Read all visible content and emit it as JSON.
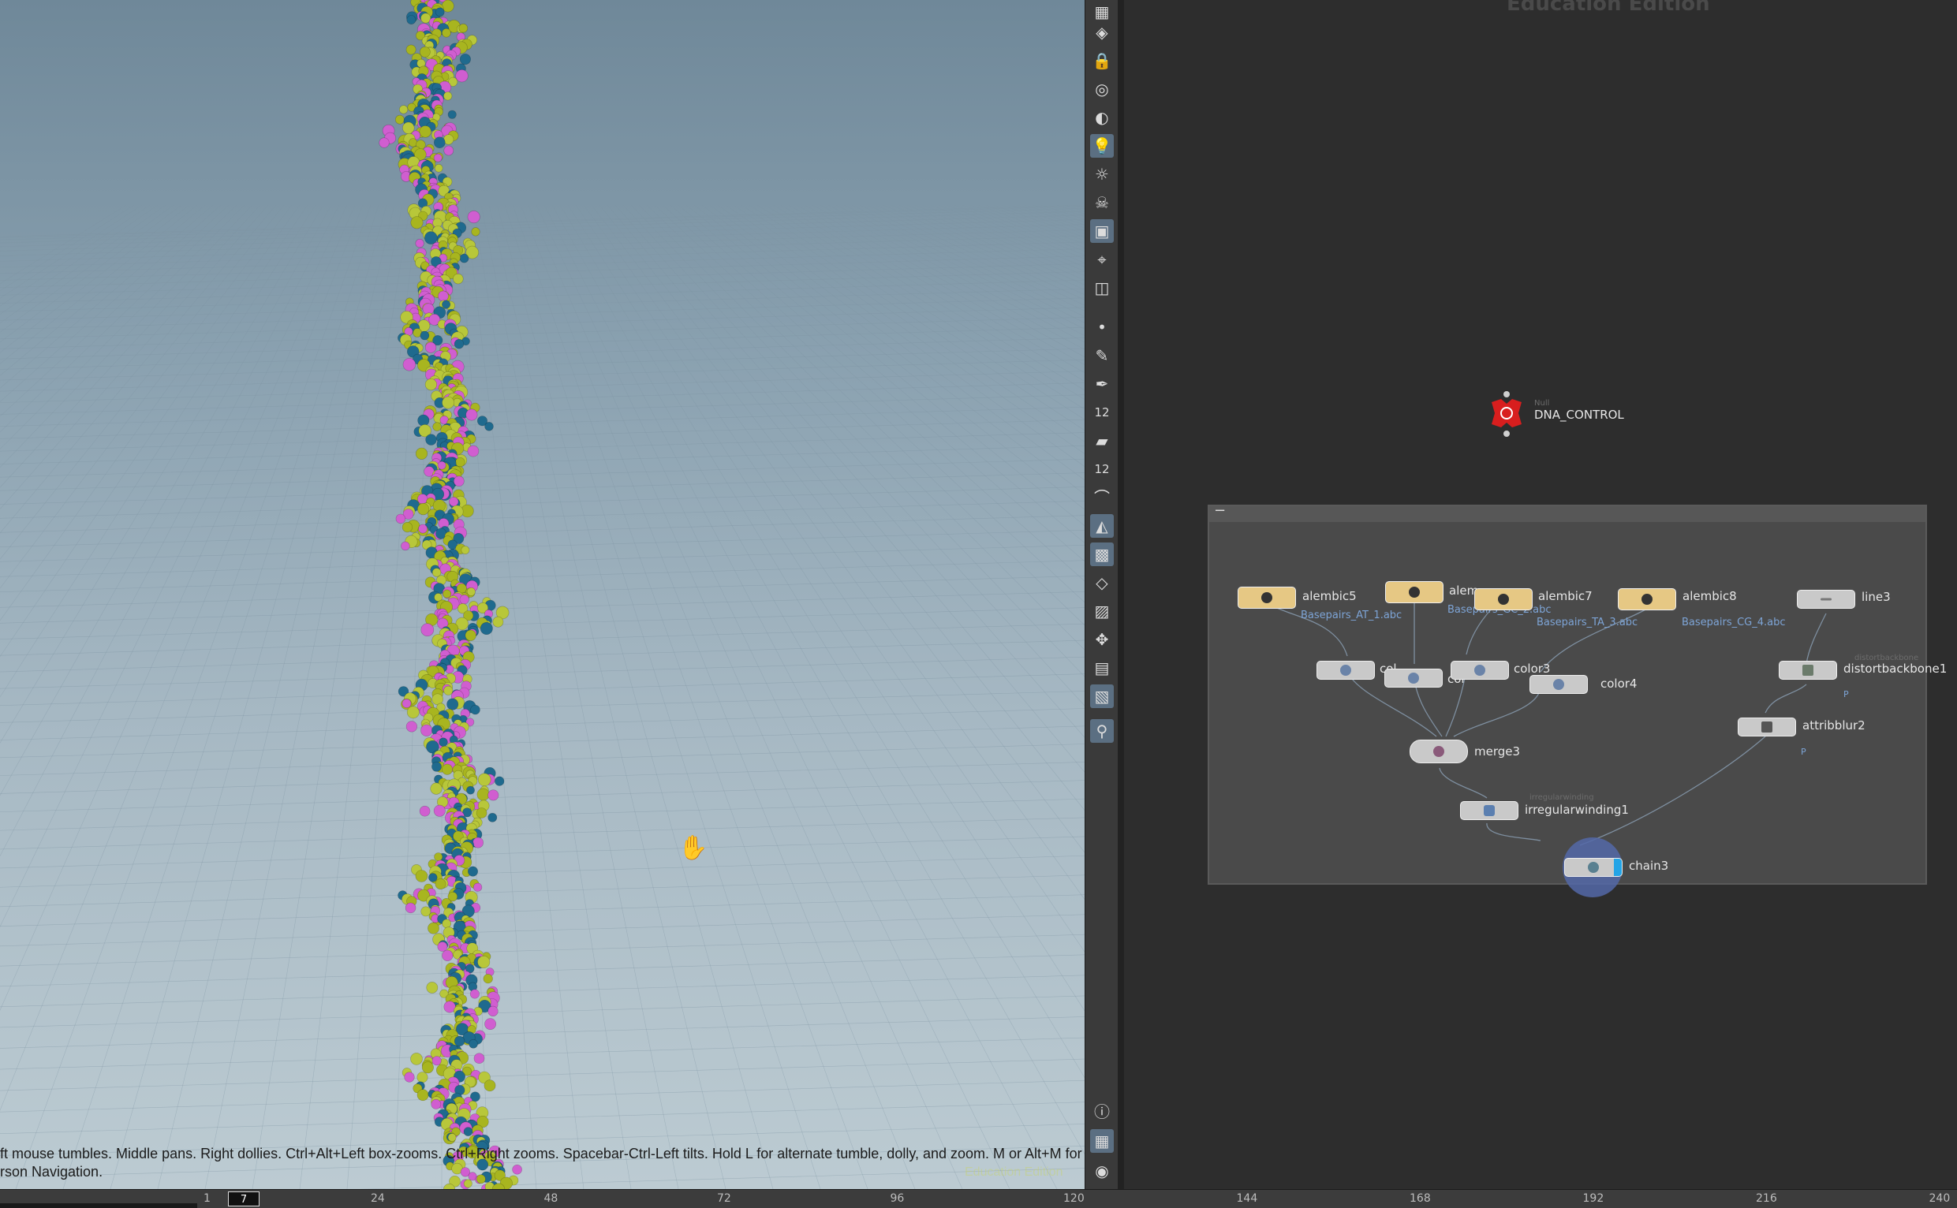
{
  "viewport": {
    "hint_line1": "ft mouse tumbles. Middle pans. Right dollies. Ctrl+Alt+Left box-zooms. Ctrl+Right zooms. Spacebar-Ctrl-Left tilts. Hold L for alternate tumble, dolly, and zoom.     M or Alt+M for First",
    "hint_line2": "rson Navigation.",
    "education_watermark": "Education Edition",
    "cursor_icon": "hand-pan-icon",
    "dna_colors": [
      "#a8b51f",
      "#d05ed0",
      "#1f6a8e",
      "#b8c73a"
    ]
  },
  "toolbar": {
    "tools": [
      "wireframe-icon",
      "display-icon",
      "lock-icon",
      "ghost-icon",
      "shading-icon",
      "light-icon",
      "headlight-icon",
      "skull-icon",
      "camera-icon",
      "camera-view-icon",
      "snapshot-icon",
      "point-icon",
      "brush-icon",
      "pen-icon",
      "number-icon",
      "paint-icon",
      "number2-icon",
      "curve-icon",
      "surface-icon",
      "checker-icon",
      "layers-icon",
      "texture-icon",
      "transform-icon",
      "viewport-icon",
      "background-icon",
      "pin-icon",
      "info-icon",
      "layout-icon",
      "eye-icon"
    ],
    "number_label_1": "12",
    "number_label_2": "12"
  },
  "network": {
    "watermark": "Education Edition",
    "box_collapse": "−",
    "null_node": {
      "type": "Null",
      "name": "DNA_CONTROL"
    },
    "nodes": {
      "alembic5": {
        "name": "alembic5",
        "file": "Basepairs_AT_1.abc"
      },
      "alembic6": {
        "name": "alem",
        "file": "Basepairs_GC_2.abc"
      },
      "alembic7": {
        "name": "alembic7",
        "file": "Basepairs_TA_3.abc"
      },
      "alembic8": {
        "name": "alembic8",
        "file": "Basepairs_CG_4.abc"
      },
      "line3": {
        "name": "line3"
      },
      "color1": {
        "name": "col"
      },
      "color2": {
        "name": "col"
      },
      "color3": {
        "name": "color3"
      },
      "color4": {
        "name": "color4"
      },
      "distortbackbone1": {
        "name": "distortbackbone1",
        "type": "distortbackbone",
        "flag": "P"
      },
      "attribblur2": {
        "name": "attribblur2",
        "flag": "P"
      },
      "merge3": {
        "name": "merge3"
      },
      "irregularwinding1": {
        "name": "irregularwinding1",
        "type": "irregularwinding"
      },
      "chain3": {
        "name": "chain3"
      }
    }
  },
  "timeline": {
    "start_frame": "1",
    "current_frame": "7",
    "ticks": [
      "24",
      "48",
      "72",
      "96",
      "120",
      "144",
      "168",
      "192",
      "216",
      "240"
    ]
  }
}
